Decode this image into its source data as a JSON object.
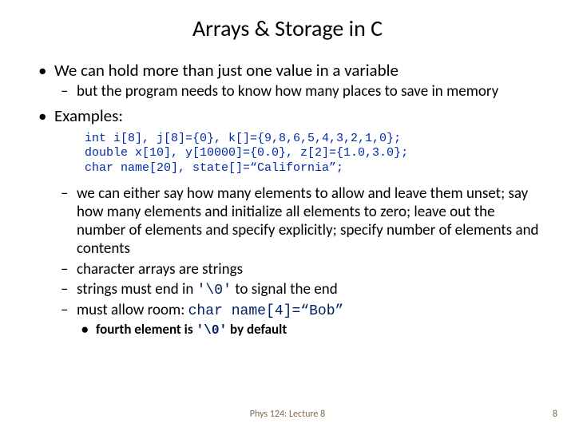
{
  "title": "Arrays & Storage in C",
  "bullets": {
    "b1": "We can hold more than just one value in a variable",
    "b1a": "but the program needs to know how many places to save in memory",
    "b2": "Examples:",
    "code1": "int i[8], j[8]={0}, k[]={9,8,6,5,4,3,2,1,0};",
    "code2": "double x[10], y[10000]={0.0}, z[2]={1.0,3.0};",
    "code3": "char name[20], state[]=“California”;",
    "b2a": "we can either say how many elements to allow and leave them unset; say how many elements and initialize all elements to zero; leave out the number of elements and specify explicitly; specify number of elements and contents",
    "b2b": "character arrays are strings",
    "b2c_pre": "strings must end in ",
    "b2c_code": "'\\0'",
    "b2c_post": " to signal the end",
    "b2d_pre": "must allow room: ",
    "b2d_code": "char name[4]=“Bob”",
    "b2d1_pre": "fourth element is ",
    "b2d1_code": "'\\0'",
    "b2d1_post": " by default"
  },
  "footer": {
    "center": "Phys 124: Lecture 8",
    "page": "8"
  }
}
